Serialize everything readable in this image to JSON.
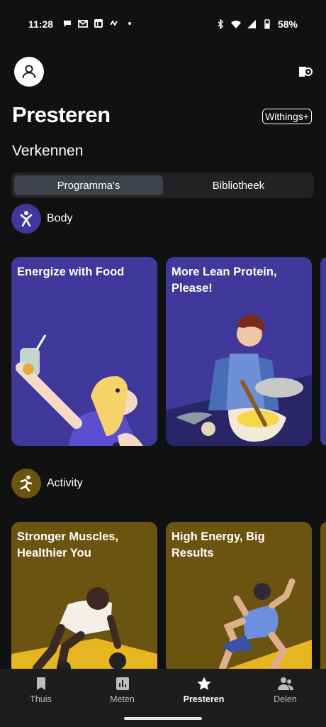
{
  "status_bar": {
    "time": "11:28",
    "battery": "58%"
  },
  "header": {
    "title": "Presteren",
    "withings_label": "Withings+"
  },
  "explore": {
    "title": "Verkennen"
  },
  "tabs": [
    {
      "label": "Programma's",
      "active": true
    },
    {
      "label": "Bibliotheek",
      "active": false
    }
  ],
  "categories": [
    {
      "label": "Body",
      "icon": "body-icon",
      "color": "#40389a",
      "cards": [
        {
          "title": "Energize with Food",
          "color": "#40389a"
        },
        {
          "title": "More Lean Protein, Please!",
          "color": "#40389a"
        }
      ]
    },
    {
      "label": "Activity",
      "icon": "running-icon",
      "color": "#6b5410",
      "cards": [
        {
          "title": "Stronger Muscles, Healthier You",
          "color": "#6b5410"
        },
        {
          "title": "High Energy, Big Results",
          "color": "#6b5410"
        }
      ]
    }
  ],
  "bottom_nav": [
    {
      "label": "Thuis",
      "icon": "bookmark-icon",
      "active": false
    },
    {
      "label": "Meten",
      "icon": "bar-chart-icon",
      "active": false
    },
    {
      "label": "Presteren",
      "icon": "star-icon",
      "active": true
    },
    {
      "label": "Delen",
      "icon": "people-icon",
      "active": false
    }
  ]
}
